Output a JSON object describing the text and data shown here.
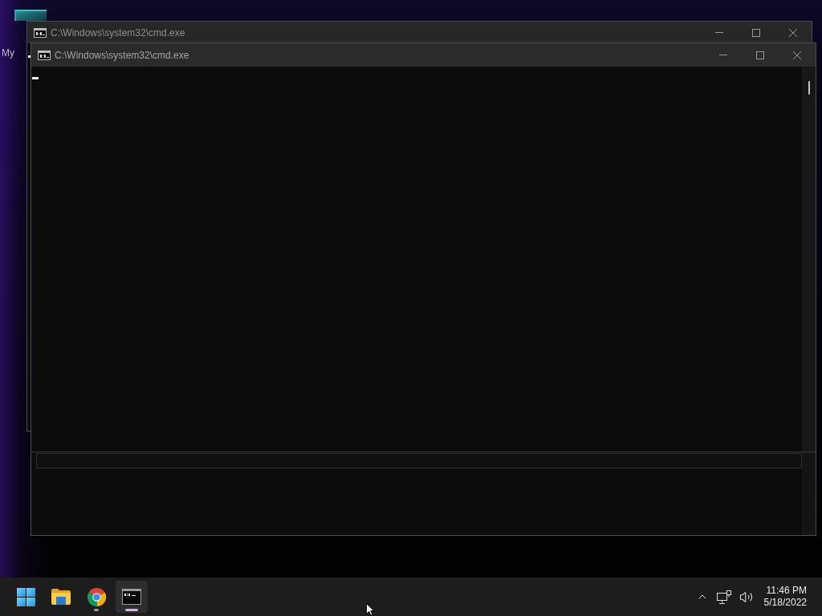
{
  "desktop": {
    "icons": [
      {
        "label": "My"
      }
    ]
  },
  "windows": [
    {
      "title": "C:\\Windows\\system32\\cmd.exe"
    },
    {
      "title": "C:\\Windows\\system32\\cmd.exe"
    }
  ],
  "taskbar": {
    "apps": [
      {
        "kind": "start",
        "running": false,
        "selected": false
      },
      {
        "kind": "explorer",
        "running": false,
        "selected": false
      },
      {
        "kind": "browser",
        "running": true,
        "selected": false
      },
      {
        "kind": "terminal",
        "running": true,
        "selected": true
      }
    ],
    "clock": {
      "time": "11:46 PM",
      "date": "5/18/2022"
    }
  }
}
